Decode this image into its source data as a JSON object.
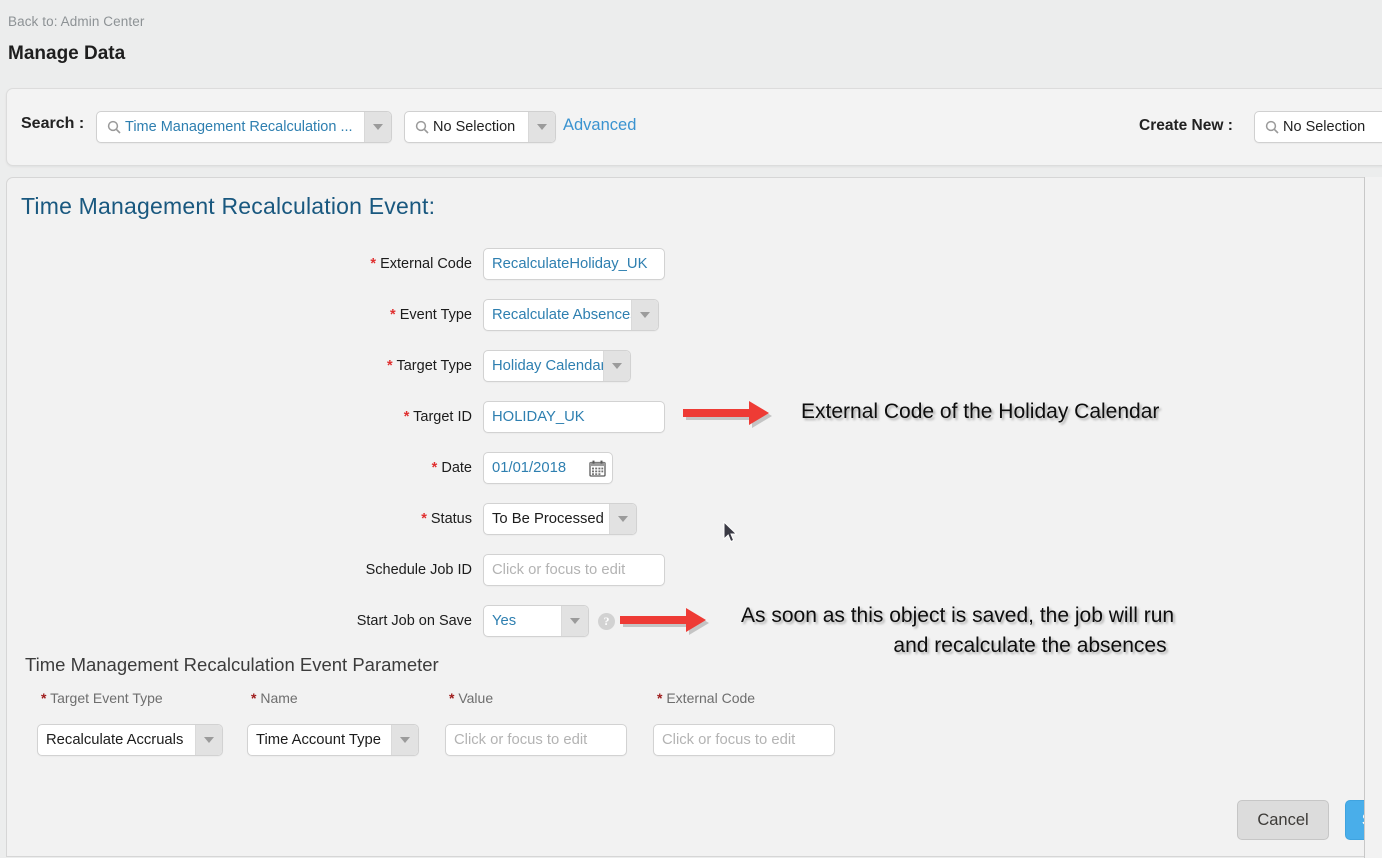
{
  "header": {
    "back_link": "Back to: Admin Center",
    "page_title": "Manage Data"
  },
  "search_bar": {
    "search_label": "Search :",
    "entity_value": "Time Management Recalculation ...",
    "selection_value": "No Selection",
    "advanced_label": "Advanced",
    "create_new_label": "Create New :",
    "create_new_value": "No Selection",
    "search_icon": "magnifier-icon"
  },
  "form": {
    "title": "Time Management Recalculation Event:",
    "fields": [
      {
        "label": "External Code",
        "required": true,
        "value": "RecalculateHoliday_UK",
        "type": "text",
        "style": "blue"
      },
      {
        "label": "Event Type",
        "required": true,
        "value": "Recalculate Absences",
        "type": "select",
        "style": "blue"
      },
      {
        "label": "Target Type",
        "required": true,
        "value": "Holiday Calendar",
        "type": "select",
        "style": "blue"
      },
      {
        "label": "Target ID",
        "required": true,
        "value": "HOLIDAY_UK",
        "type": "text",
        "style": "blue"
      },
      {
        "label": "Date",
        "required": true,
        "value": "01/01/2018",
        "type": "date",
        "style": "blue"
      },
      {
        "label": "Status",
        "required": true,
        "value": "To Be Processed",
        "type": "select",
        "style": "dark"
      },
      {
        "label": "Schedule Job ID",
        "required": false,
        "value": "Click or focus to edit",
        "type": "text",
        "style": "placeholder"
      },
      {
        "label": "Start Job on Save",
        "required": false,
        "value": "Yes",
        "type": "select",
        "style": "blue"
      }
    ],
    "help_icon": "question-mark-icon",
    "calendar_icon": "calendar-icon",
    "dropdown_icon": "chevron-down-icon"
  },
  "parameter_section": {
    "title": "Time Management Recalculation Event Parameter",
    "columns": [
      {
        "label": "Target Event Type",
        "required": true,
        "value": "Recalculate Accruals",
        "type": "select",
        "style": "dark"
      },
      {
        "label": "Name",
        "required": true,
        "value": "Time Account Type",
        "type": "select",
        "style": "dark"
      },
      {
        "label": "Value",
        "required": true,
        "value": "Click or focus to edit",
        "type": "text",
        "style": "placeholder"
      },
      {
        "label": "External Code",
        "required": true,
        "value": "Click or focus to edit",
        "type": "text",
        "style": "placeholder"
      }
    ]
  },
  "footer": {
    "cancel_label": "Cancel",
    "save_label": "Sav"
  },
  "annotations": [
    {
      "text": "External Code of the Holiday Calendar",
      "arrow_color": "#ee3b35"
    },
    {
      "line1": "As soon as this object is saved, the job will run",
      "line2": "and recalculate the absences",
      "arrow_color": "#ee3b35"
    }
  ],
  "colors": {
    "page_background": "#eceded",
    "panel_background": "#f2f2f2",
    "title_blue": "#19587f",
    "link_blue": "#3a93d0",
    "value_blue": "#2e7fb0",
    "required_red": "#e03030",
    "arrow_red": "#ee3b35",
    "save_blue": "#49aeea"
  }
}
